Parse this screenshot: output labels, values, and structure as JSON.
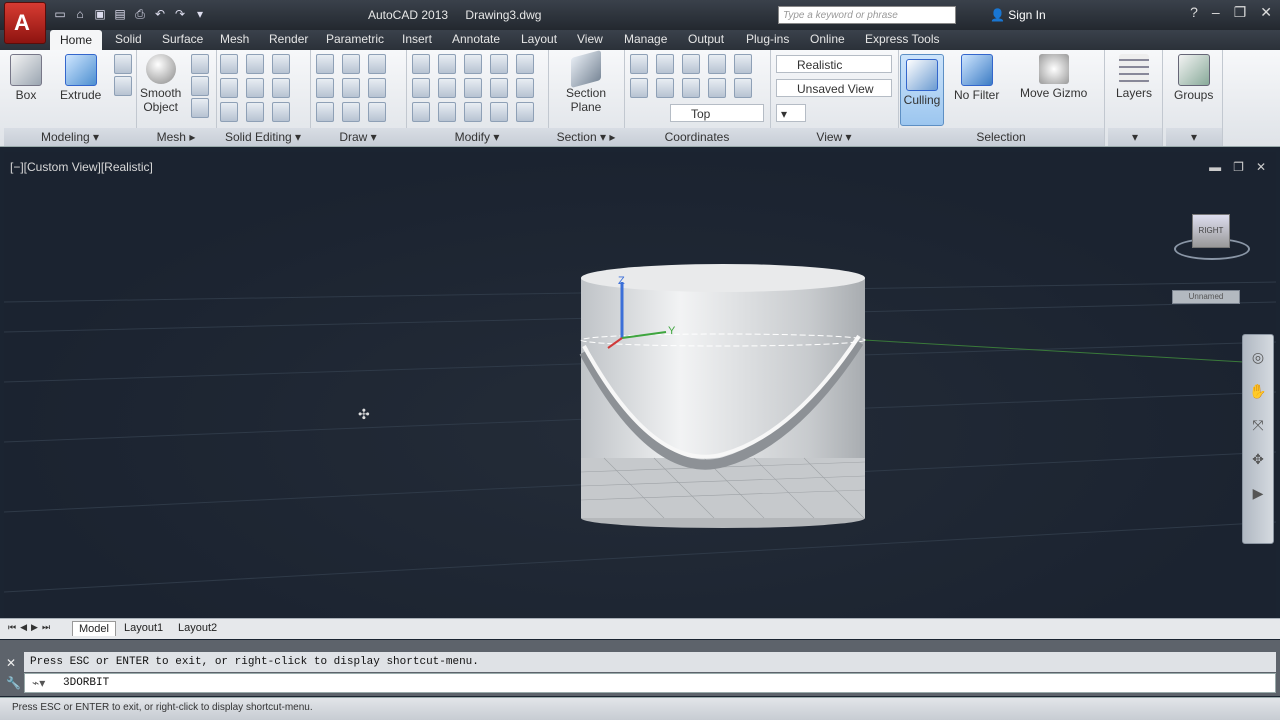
{
  "title": {
    "app": "AutoCAD 2013",
    "file": "Drawing3.dwg"
  },
  "search": {
    "placeholder": "Type a keyword or phrase"
  },
  "signin": "Sign In",
  "tabs": [
    "Home",
    "Solid",
    "Surface",
    "Mesh",
    "Render",
    "Parametric",
    "Insert",
    "Annotate",
    "Layout",
    "View",
    "Manage",
    "Output",
    "Plug-ins",
    "Online",
    "Express Tools"
  ],
  "ribbon": {
    "modeling": {
      "label": "Modeling",
      "box": "Box",
      "extrude": "Extrude"
    },
    "mesh": {
      "label": "Mesh",
      "smooth": "Smooth",
      "object": "Object"
    },
    "solid_editing": {
      "label": "Solid Editing"
    },
    "draw": {
      "label": "Draw"
    },
    "modify": {
      "label": "Modify"
    },
    "section": {
      "label": "Section",
      "plane_1": "Section",
      "plane_2": "Plane"
    },
    "coordinates": {
      "label": "Coordinates",
      "view_dd": "Top"
    },
    "view": {
      "label": "View",
      "visual_style": "Realistic",
      "saved_view": "Unsaved View"
    },
    "selection": {
      "label": "Selection",
      "culling": "Culling",
      "no_filter": "No Filter",
      "move_gizmo": "Move Gizmo"
    },
    "layers": "Layers",
    "groups": "Groups"
  },
  "viewport": {
    "label": "[−][Custom View][Realistic]",
    "wcs": "Unnamed",
    "cube_face": "RIGHT"
  },
  "layout_tabs": [
    "Model",
    "Layout1",
    "Layout2"
  ],
  "command": {
    "history": "Press ESC or ENTER to exit, or right-click to display shortcut-menu.",
    "input": "3DORBIT"
  },
  "status": "Press ESC or ENTER to exit, or right-click to display shortcut-menu."
}
